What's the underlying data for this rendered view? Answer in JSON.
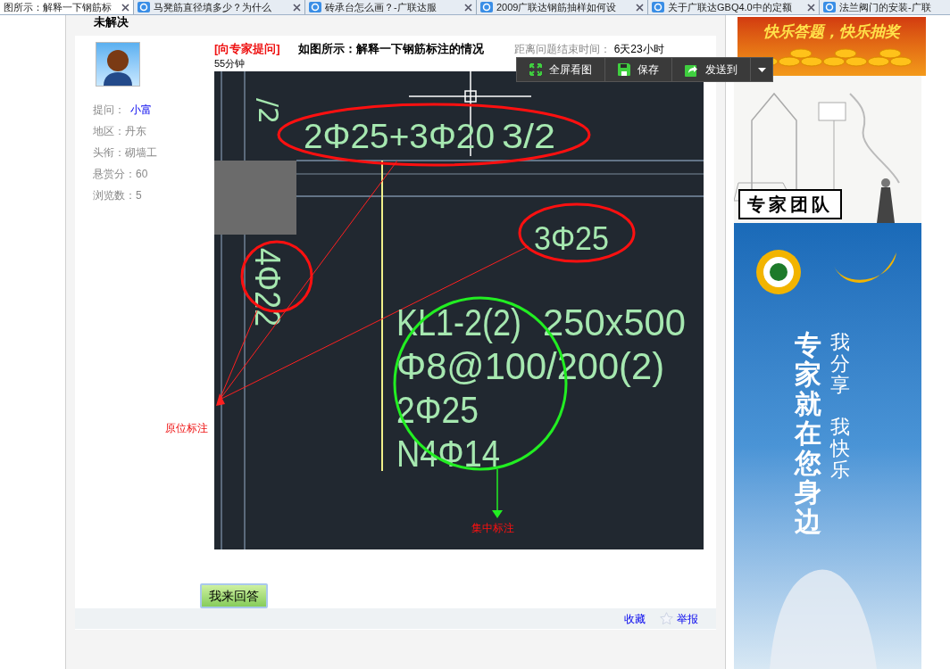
{
  "tabs": [
    {
      "label": "图所示：解释一下钢筋标",
      "selected": true
    },
    {
      "label": "马凳筋直径填多少？为什么",
      "selected": false
    },
    {
      "label": "砖承台怎么画？-广联达服",
      "selected": false
    },
    {
      "label": "2009广联达钢筋抽样如何设",
      "selected": false
    },
    {
      "label": "关于广联达GBQ4.0中的定额",
      "selected": false
    },
    {
      "label": "法兰阀门的安装-广联",
      "selected": false
    }
  ],
  "status": "未解决",
  "asker": {
    "label": "提问：",
    "name": "小富",
    "info": [
      "地区：丹东",
      "头衔：砌墙工",
      "悬赏分：60",
      "浏览数：5"
    ]
  },
  "question": {
    "tag": "[向专家提问]",
    "title": "如图所示：解释一下钢筋标注的情况",
    "countdown_label": "距离问题结束时间：",
    "countdown_value": "6天23小时",
    "countdown_rest": "55分钟"
  },
  "toolbar": [
    {
      "kind": "fullscreen",
      "label": "全屏看图"
    },
    {
      "kind": "save",
      "label": "保存"
    },
    {
      "kind": "send",
      "label": "发送到"
    }
  ],
  "drawing": {
    "corner_label": "/2",
    "top_label": [
      "2Φ25+3Φ20",
      "3/2"
    ],
    "left_label": "4Φ22",
    "right_label": "3Φ25",
    "lines": [
      [
        "KL1-2(2)",
        "250x500"
      ],
      [
        "Φ8@100/200(2)"
      ],
      [
        "2Φ25"
      ],
      [
        "N4Φ14"
      ]
    ],
    "callout_left": "原位标注",
    "callout_center": "集中标注"
  },
  "answer_button": "我来回答",
  "footer": {
    "favorite": "收藏",
    "report": "举报"
  },
  "ads": {
    "banner": "快乐答题，快乐抽奖",
    "team": "专家团队",
    "poster_main": "专家就在您身边",
    "poster_side": [
      "我分享",
      "我快乐"
    ]
  }
}
